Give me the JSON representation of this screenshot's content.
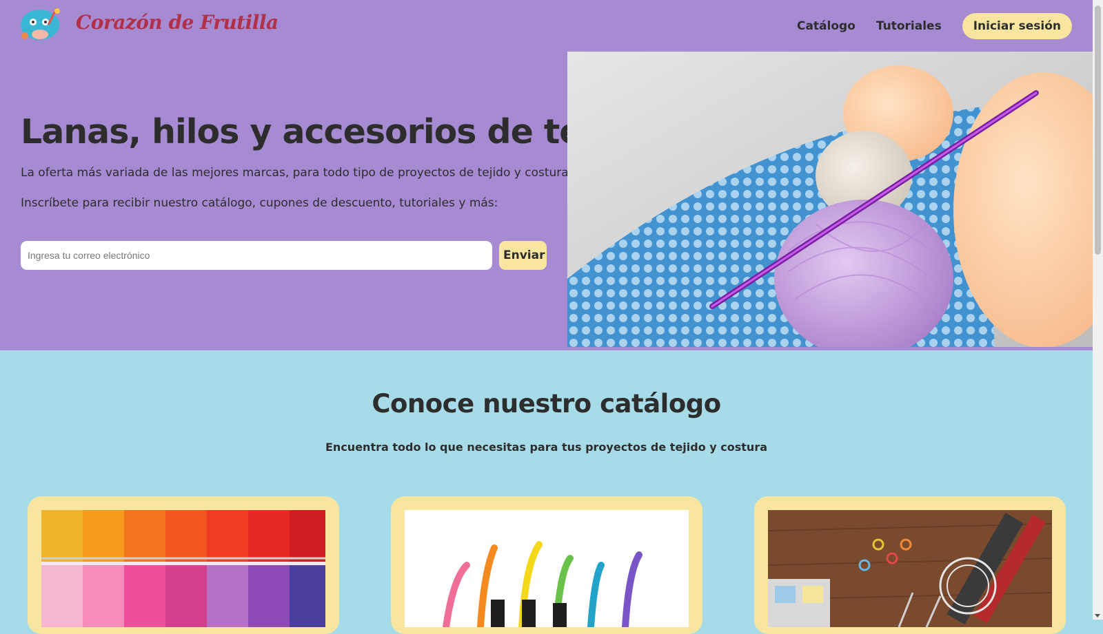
{
  "header": {
    "brand": "Corazón de Frutilla",
    "nav": {
      "catalog": "Catálogo",
      "tutorials": "Tutoriales",
      "login": "Iniciar sesión"
    }
  },
  "hero": {
    "title": "Lanas, hilos y accesorios de tejido",
    "paragraph1": "La oferta más variada de las mejores marcas, para todo tipo de proyectos de tejido y costura.",
    "paragraph2": "Inscríbete para recibir nuestro catálogo, cupones de descuento, tutoriales y más:",
    "email_placeholder": "Ingresa tu correo electrónico",
    "send_label": "Enviar"
  },
  "catalog": {
    "title": "Conoce nuestro catálogo",
    "subtitle": "Encuentra todo lo que necesitas para tus proyectos de tejido y costura"
  },
  "colors": {
    "purple": "#a68bd3",
    "cyan": "#a8dbe8",
    "cream": "#f8e6a0",
    "brand_red": "#b0304a",
    "text": "#2d2d2d"
  }
}
